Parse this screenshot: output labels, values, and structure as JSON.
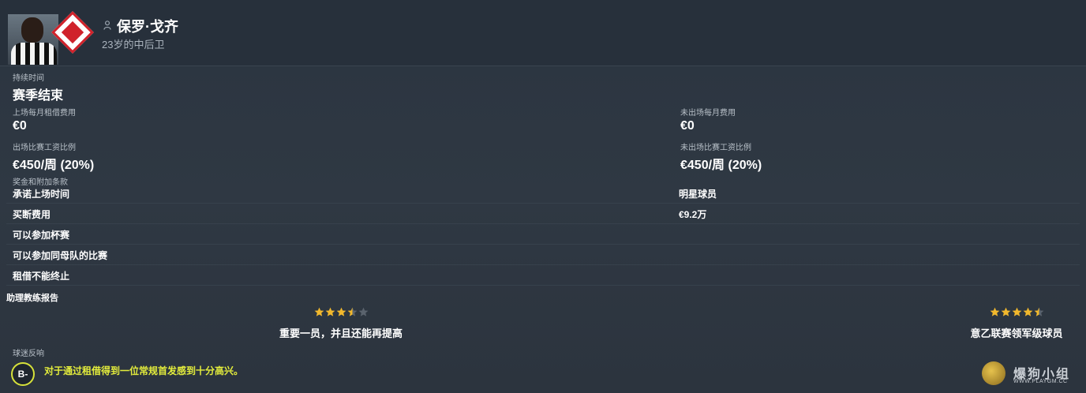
{
  "player": {
    "name": "保罗·戈齐",
    "subtitle": "23岁的中后卫"
  },
  "contract": {
    "duration_label": "持续时间",
    "duration_value": "赛季结束",
    "monthly_fee_played_label": "上场每月租借费用",
    "monthly_fee_played_value": "€0",
    "monthly_fee_unplayed_label": "未出场每月费用",
    "monthly_fee_unplayed_value": "€0",
    "wage_played_label": "出场比赛工资比例",
    "wage_played_value": "€450/周 (20%)",
    "wage_unplayed_label": "未出场比赛工资比例",
    "wage_unplayed_value": "€450/周 (20%)",
    "bonus_label": "奖金和附加条款",
    "clauses": [
      {
        "left": "承诺上场时间",
        "right": "明星球员"
      },
      {
        "left": "买断费用",
        "right": "€9.2万"
      },
      {
        "left": "可以参加杯赛",
        "right": ""
      },
      {
        "left": "可以参加同母队的比赛",
        "right": ""
      },
      {
        "left": "租借不能终止",
        "right": ""
      }
    ]
  },
  "coach_report": {
    "label": "助理教练报告",
    "current": {
      "stars": 3.5,
      "max": 5,
      "text": "重要一员，并且还能再提高"
    },
    "potential": {
      "stars": 4.5,
      "max": 5,
      "text": "意乙联赛领军级球员"
    }
  },
  "fan_reaction": {
    "label": "球迷反响",
    "grade": "B-",
    "text": "对于通过租借得到一位常规首发感到十分高兴。"
  },
  "watermark": {
    "text": "爆狗小组",
    "url": "WWW.PLAYGM.CC"
  },
  "colors": {
    "star": "#f1b82d",
    "star_empty": "#5a636d",
    "fan_text": "#e3ec3c",
    "badge_red": "#d0222b"
  }
}
